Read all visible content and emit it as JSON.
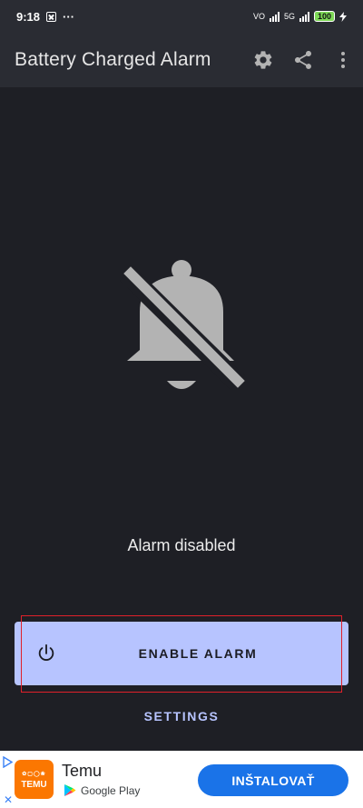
{
  "status_bar": {
    "time": "9:18",
    "more": "···",
    "network": "5G",
    "vo_label": "VO",
    "battery": "100"
  },
  "app_bar": {
    "title": "Battery Charged Alarm",
    "icons": [
      "gear-icon",
      "share-icon",
      "more-vert-icon"
    ]
  },
  "main": {
    "state_icon": "bell-off-icon",
    "status_text": "Alarm disabled",
    "enable_button": {
      "label": "ENABLE ALARM",
      "icon": "power-icon"
    },
    "settings_button": {
      "label": "SETTINGS"
    }
  },
  "ad": {
    "app_name": "Temu",
    "store": "Google Play",
    "logo_text": "TEMU",
    "logo_subtext": "✿▢◯❀",
    "install_label": "INŠTALOVAŤ",
    "close_glyph": "✕"
  },
  "colors": {
    "background": "#1e1f25",
    "app_bar": "#2a2c33",
    "accent": "#b7c4ff",
    "icon_gray": "#b3b3b3",
    "ad_button": "#1a73e8",
    "highlight": "#e0202a"
  }
}
